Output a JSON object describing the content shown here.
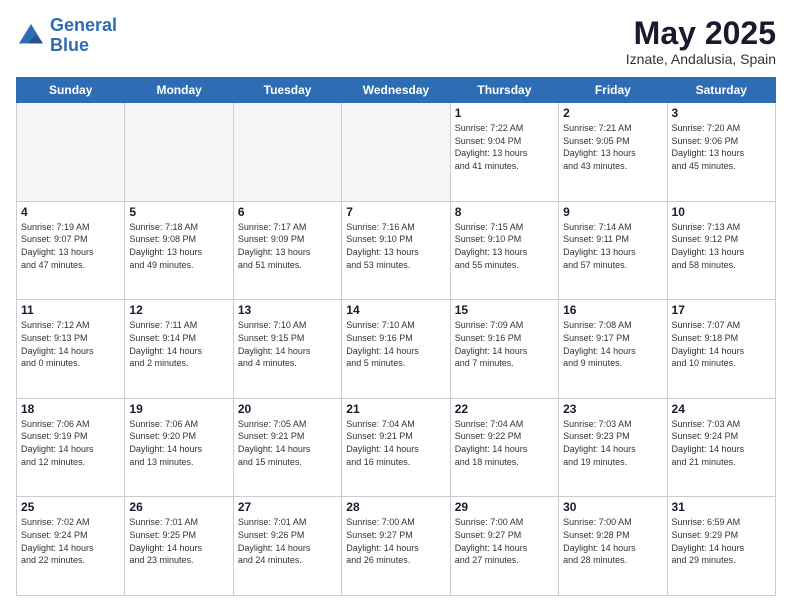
{
  "header": {
    "logo_line1": "General",
    "logo_line2": "Blue",
    "month_title": "May 2025",
    "location": "Iznate, Andalusia, Spain"
  },
  "weekdays": [
    "Sunday",
    "Monday",
    "Tuesday",
    "Wednesday",
    "Thursday",
    "Friday",
    "Saturday"
  ],
  "weeks": [
    [
      {
        "day": "",
        "text": ""
      },
      {
        "day": "",
        "text": ""
      },
      {
        "day": "",
        "text": ""
      },
      {
        "day": "",
        "text": ""
      },
      {
        "day": "1",
        "text": "Sunrise: 7:22 AM\nSunset: 9:04 PM\nDaylight: 13 hours\nand 41 minutes."
      },
      {
        "day": "2",
        "text": "Sunrise: 7:21 AM\nSunset: 9:05 PM\nDaylight: 13 hours\nand 43 minutes."
      },
      {
        "day": "3",
        "text": "Sunrise: 7:20 AM\nSunset: 9:06 PM\nDaylight: 13 hours\nand 45 minutes."
      }
    ],
    [
      {
        "day": "4",
        "text": "Sunrise: 7:19 AM\nSunset: 9:07 PM\nDaylight: 13 hours\nand 47 minutes."
      },
      {
        "day": "5",
        "text": "Sunrise: 7:18 AM\nSunset: 9:08 PM\nDaylight: 13 hours\nand 49 minutes."
      },
      {
        "day": "6",
        "text": "Sunrise: 7:17 AM\nSunset: 9:09 PM\nDaylight: 13 hours\nand 51 minutes."
      },
      {
        "day": "7",
        "text": "Sunrise: 7:16 AM\nSunset: 9:10 PM\nDaylight: 13 hours\nand 53 minutes."
      },
      {
        "day": "8",
        "text": "Sunrise: 7:15 AM\nSunset: 9:10 PM\nDaylight: 13 hours\nand 55 minutes."
      },
      {
        "day": "9",
        "text": "Sunrise: 7:14 AM\nSunset: 9:11 PM\nDaylight: 13 hours\nand 57 minutes."
      },
      {
        "day": "10",
        "text": "Sunrise: 7:13 AM\nSunset: 9:12 PM\nDaylight: 13 hours\nand 58 minutes."
      }
    ],
    [
      {
        "day": "11",
        "text": "Sunrise: 7:12 AM\nSunset: 9:13 PM\nDaylight: 14 hours\nand 0 minutes."
      },
      {
        "day": "12",
        "text": "Sunrise: 7:11 AM\nSunset: 9:14 PM\nDaylight: 14 hours\nand 2 minutes."
      },
      {
        "day": "13",
        "text": "Sunrise: 7:10 AM\nSunset: 9:15 PM\nDaylight: 14 hours\nand 4 minutes."
      },
      {
        "day": "14",
        "text": "Sunrise: 7:10 AM\nSunset: 9:16 PM\nDaylight: 14 hours\nand 5 minutes."
      },
      {
        "day": "15",
        "text": "Sunrise: 7:09 AM\nSunset: 9:16 PM\nDaylight: 14 hours\nand 7 minutes."
      },
      {
        "day": "16",
        "text": "Sunrise: 7:08 AM\nSunset: 9:17 PM\nDaylight: 14 hours\nand 9 minutes."
      },
      {
        "day": "17",
        "text": "Sunrise: 7:07 AM\nSunset: 9:18 PM\nDaylight: 14 hours\nand 10 minutes."
      }
    ],
    [
      {
        "day": "18",
        "text": "Sunrise: 7:06 AM\nSunset: 9:19 PM\nDaylight: 14 hours\nand 12 minutes."
      },
      {
        "day": "19",
        "text": "Sunrise: 7:06 AM\nSunset: 9:20 PM\nDaylight: 14 hours\nand 13 minutes."
      },
      {
        "day": "20",
        "text": "Sunrise: 7:05 AM\nSunset: 9:21 PM\nDaylight: 14 hours\nand 15 minutes."
      },
      {
        "day": "21",
        "text": "Sunrise: 7:04 AM\nSunset: 9:21 PM\nDaylight: 14 hours\nand 16 minutes."
      },
      {
        "day": "22",
        "text": "Sunrise: 7:04 AM\nSunset: 9:22 PM\nDaylight: 14 hours\nand 18 minutes."
      },
      {
        "day": "23",
        "text": "Sunrise: 7:03 AM\nSunset: 9:23 PM\nDaylight: 14 hours\nand 19 minutes."
      },
      {
        "day": "24",
        "text": "Sunrise: 7:03 AM\nSunset: 9:24 PM\nDaylight: 14 hours\nand 21 minutes."
      }
    ],
    [
      {
        "day": "25",
        "text": "Sunrise: 7:02 AM\nSunset: 9:24 PM\nDaylight: 14 hours\nand 22 minutes."
      },
      {
        "day": "26",
        "text": "Sunrise: 7:01 AM\nSunset: 9:25 PM\nDaylight: 14 hours\nand 23 minutes."
      },
      {
        "day": "27",
        "text": "Sunrise: 7:01 AM\nSunset: 9:26 PM\nDaylight: 14 hours\nand 24 minutes."
      },
      {
        "day": "28",
        "text": "Sunrise: 7:00 AM\nSunset: 9:27 PM\nDaylight: 14 hours\nand 26 minutes."
      },
      {
        "day": "29",
        "text": "Sunrise: 7:00 AM\nSunset: 9:27 PM\nDaylight: 14 hours\nand 27 minutes."
      },
      {
        "day": "30",
        "text": "Sunrise: 7:00 AM\nSunset: 9:28 PM\nDaylight: 14 hours\nand 28 minutes."
      },
      {
        "day": "31",
        "text": "Sunrise: 6:59 AM\nSunset: 9:29 PM\nDaylight: 14 hours\nand 29 minutes."
      }
    ]
  ]
}
